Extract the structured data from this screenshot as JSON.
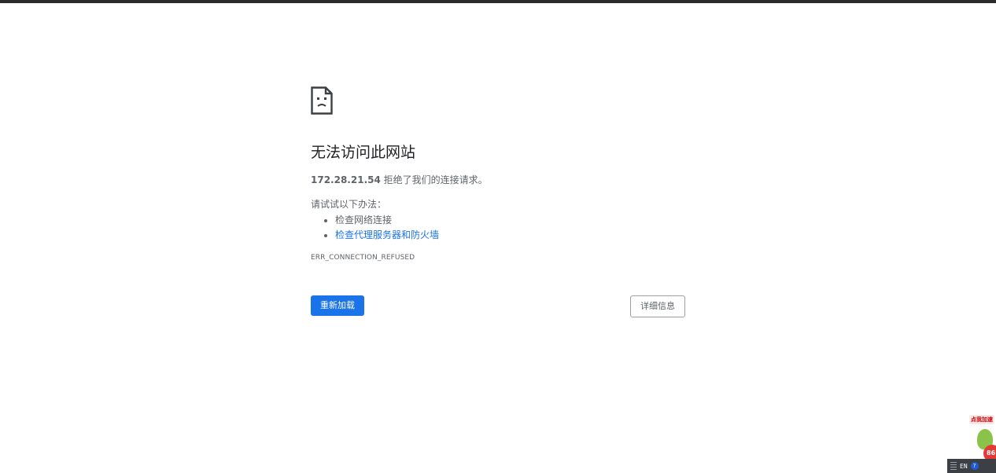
{
  "error_page": {
    "title": "无法访问此网站",
    "host": "172.28.21.54",
    "reason_suffix": " 拒绝了我们的连接请求。",
    "try_label": "请试试以下办法：",
    "suggestions": [
      {
        "label": "检查网络连接",
        "link": false
      },
      {
        "label": "检查代理服务器和防火墙",
        "link": true
      }
    ],
    "error_code": "ERR_CONNECTION_REFUSED",
    "reload_label": "重新加载",
    "details_label": "详细信息",
    "icon": "sad-page-icon"
  },
  "overlay": {
    "speed_widget_label": "点我加速",
    "speed_badge_value": "86",
    "language_indicator": "EN",
    "help_glyph": "?"
  },
  "colors": {
    "accent": "#1a73e8",
    "text_primary": "#202124",
    "text_secondary": "#5f6368",
    "top_bar": "#2b2b2b"
  }
}
